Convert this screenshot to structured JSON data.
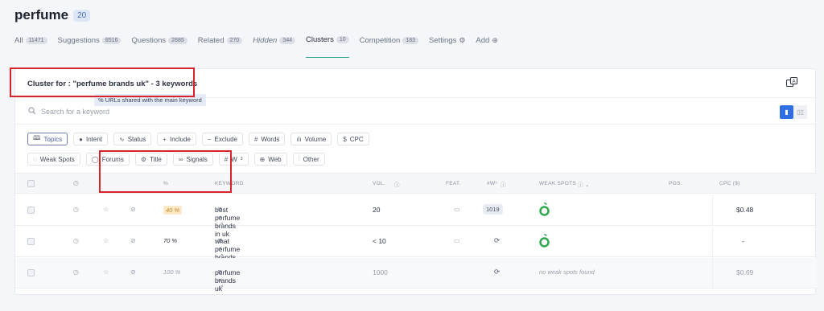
{
  "page": {
    "title": "perfume",
    "count": "20"
  },
  "tabs": [
    {
      "label": "All",
      "badge": "11471"
    },
    {
      "label": "Suggestions",
      "badge": "8516"
    },
    {
      "label": "Questions",
      "badge": "2685"
    },
    {
      "label": "Related",
      "badge": "270"
    },
    {
      "label": "Hidden",
      "badge": "344"
    },
    {
      "label": "Clusters",
      "badge": "10"
    },
    {
      "label": "Competition",
      "badge": "183"
    },
    {
      "label": "Settings",
      "badge": ""
    },
    {
      "label": "Add",
      "badge": ""
    }
  ],
  "cluster": {
    "title": "Cluster for : \"perfume brands uk\" - 3 keywords"
  },
  "search": {
    "placeholder": "Search for a keyword"
  },
  "filters_row1": [
    {
      "label": "Topics",
      "icon": "book-icon"
    },
    {
      "label": "Intent",
      "icon": "circle-icon"
    },
    {
      "label": "Status",
      "icon": "pulse-icon"
    },
    {
      "label": "Include",
      "icon": "plus-icon"
    },
    {
      "label": "Exclude",
      "icon": "minus-icon"
    },
    {
      "label": "Words",
      "icon": "hash-icon"
    },
    {
      "label": "Volume",
      "icon": "bar-chart-icon"
    },
    {
      "label": "CPC",
      "icon": "dollar-icon"
    }
  ],
  "filters_row2": [
    {
      "label": "Weak Spots",
      "icon": "apple-icon"
    },
    {
      "label": "Forums",
      "icon": "chat-icon"
    },
    {
      "label": "Title",
      "icon": "gear-icon"
    },
    {
      "label": "Signals",
      "icon": "link-icon"
    },
    {
      "label": "W",
      "icon": "hash-icon"
    },
    {
      "label": "Web",
      "icon": "globe-icon"
    },
    {
      "label": "Other",
      "icon": "sliders-icon"
    }
  ],
  "tooltip": "% URLs shared with the main keyword",
  "table": {
    "headers": {
      "pct": "%",
      "keyword": "KEYWORD",
      "vol": "VOL.",
      "feat": "FEAT.",
      "w3": "#W³",
      "weak": "WEAK SPOTS",
      "pos": "POS.",
      "cpc": "CPC ($)"
    },
    "rows": [
      {
        "pct": "40 %",
        "keyword": "best perfume brands in uk",
        "vol": "20",
        "w3": "1019",
        "weak": "",
        "cpc": "$0.48"
      },
      {
        "pct": "70 %",
        "keyword": "what perfume brands are from england",
        "vol": "< 10",
        "w3": "",
        "weak": "",
        "cpc": "-"
      },
      {
        "pct": "100 %",
        "keyword": "perfume brands uk",
        "vol": "1000",
        "w3": "",
        "weak": "no weak spots found",
        "cpc": "$0.69"
      }
    ]
  },
  "colors": {
    "accent": "#3aa89a",
    "primary": "#2f6ee0",
    "annotation": "#d8232a",
    "weak_spot": "#2fa84f"
  }
}
